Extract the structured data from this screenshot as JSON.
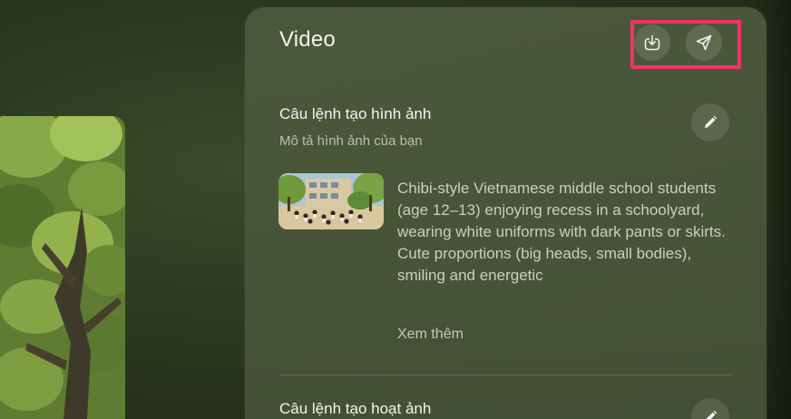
{
  "panel": {
    "title": "Video",
    "actions": {
      "download_icon": "download-icon",
      "share_icon": "send-icon"
    }
  },
  "sections": [
    {
      "title": "Câu lệnh tạo hình ảnh",
      "subtitle": "Mô tả hình ảnh của bạn",
      "prompt": "Chibi-style Vietnamese middle school students (age 12–13) enjoying recess in a schoolyard, wearing white uniforms with dark pants or skirts. Cute proportions (big heads, small bodies), smiling and energetic",
      "see_more": "Xem thêm",
      "edit_icon": "pencil-icon"
    },
    {
      "title": "Câu lệnh tạo hoạt ảnh",
      "edit_icon": "pencil-icon"
    }
  ],
  "colors": {
    "highlight": "#f0346a",
    "panel_bg": "#4e5a3c",
    "text_primary": "#f2f4ee",
    "text_secondary": "#b8c0ad"
  }
}
